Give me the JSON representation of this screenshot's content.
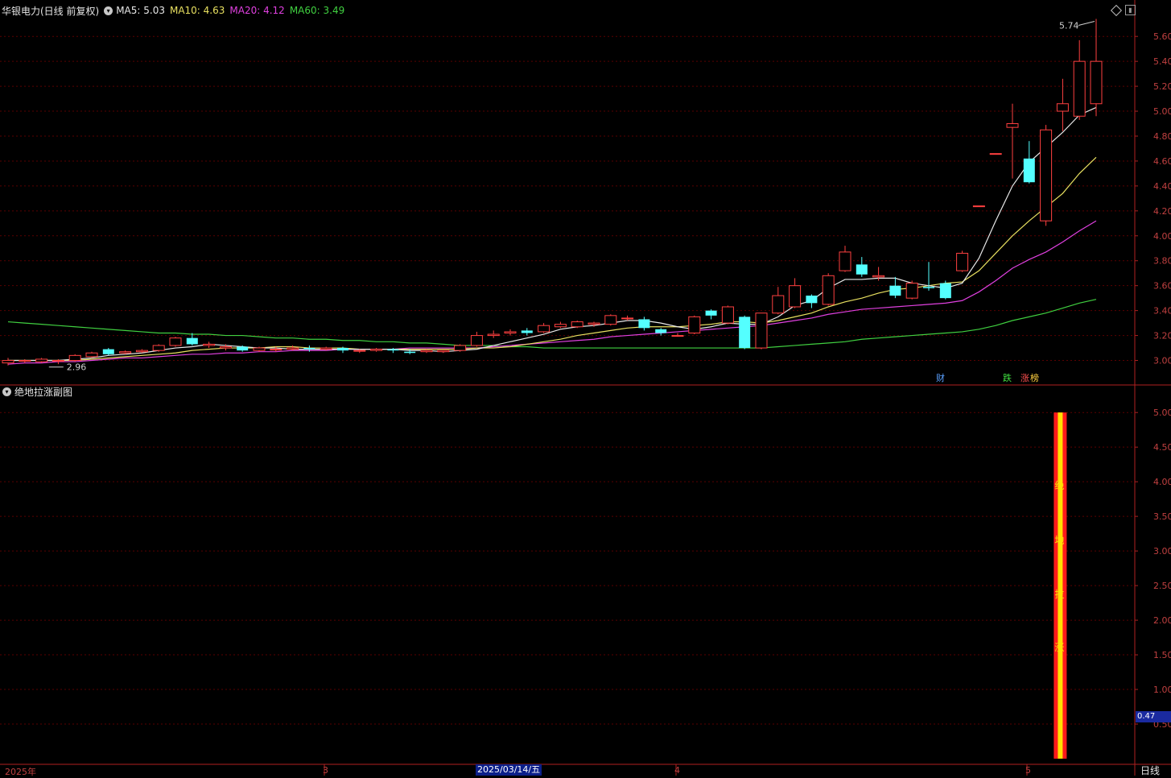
{
  "header": {
    "title": "华银电力(日线 前复权)",
    "indicators": [
      {
        "label": "MA5: 5.03",
        "color": "#e8e8e8"
      },
      {
        "label": "MA10: 4.63",
        "color": "#e8e060"
      },
      {
        "label": "MA20: 4.12",
        "color": "#e040e0"
      },
      {
        "label": "MA60: 3.49",
        "color": "#40d040"
      }
    ]
  },
  "main_axis": {
    "ticks": [
      "5.60",
      "5.40",
      "5.20",
      "5.00",
      "4.80",
      "4.60",
      "4.40",
      "4.20",
      "4.00",
      "3.80",
      "3.60",
      "3.40",
      "3.20",
      "3.00"
    ]
  },
  "annotations": {
    "high": "5.74",
    "low": "2.96"
  },
  "markers": [
    {
      "text": "财",
      "color": "#5aa0ff"
    },
    {
      "text": "跌",
      "color": "#40e040"
    },
    {
      "text": "涨",
      "color": "#ff5050"
    },
    {
      "text": "榜",
      "color": "#ffd040"
    }
  ],
  "sub": {
    "title": "绝地拉涨副图",
    "ticks": [
      "5.00",
      "4.50",
      "4.00",
      "3.50",
      "3.00",
      "2.50",
      "2.00",
      "1.50",
      "1.00",
      "0.50"
    ],
    "value_label": "0.47",
    "bar_chars": [
      "绝",
      "地",
      "拉",
      "涨"
    ]
  },
  "x_axis": {
    "labels": [
      "2025年",
      "3",
      "4",
      "5"
    ],
    "selected": "2025/03/14/五",
    "period": "日线"
  },
  "colors": {
    "up": "#ff4040",
    "down": "#54ffff",
    "grid": "#5a0000",
    "axis": "#b02020"
  },
  "chart_data": {
    "type": "candlestick",
    "ylim": [
      2.9,
      5.75
    ],
    "candles": [
      [
        2.98,
        3.0,
        2.96,
        3.02
      ],
      [
        3.0,
        3.0,
        2.98,
        3.01
      ],
      [
        2.99,
        3.01,
        2.98,
        3.02
      ],
      [
        3.0,
        3.0,
        2.97,
        3.01
      ],
      [
        3.0,
        3.04,
        2.99,
        3.05
      ],
      [
        3.03,
        3.06,
        3.02,
        3.07
      ],
      [
        3.09,
        3.05,
        3.04,
        3.1
      ],
      [
        3.06,
        3.07,
        3.05,
        3.08
      ],
      [
        3.07,
        3.08,
        3.06,
        3.09
      ],
      [
        3.08,
        3.12,
        3.07,
        3.13
      ],
      [
        3.12,
        3.18,
        3.11,
        3.19
      ],
      [
        3.18,
        3.13,
        3.12,
        3.22
      ],
      [
        3.12,
        3.13,
        3.1,
        3.15
      ],
      [
        3.1,
        3.11,
        3.08,
        3.13
      ],
      [
        3.11,
        3.08,
        3.07,
        3.12
      ],
      [
        3.08,
        3.1,
        3.07,
        3.11
      ],
      [
        3.09,
        3.09,
        3.07,
        3.11
      ],
      [
        3.09,
        3.1,
        3.08,
        3.12
      ],
      [
        3.1,
        3.09,
        3.07,
        3.12
      ],
      [
        3.09,
        3.1,
        3.08,
        3.11
      ],
      [
        3.1,
        3.08,
        3.06,
        3.11
      ],
      [
        3.08,
        3.08,
        3.06,
        3.09
      ],
      [
        3.08,
        3.09,
        3.07,
        3.1
      ],
      [
        3.09,
        3.08,
        3.06,
        3.1
      ],
      [
        3.07,
        3.06,
        3.05,
        3.09
      ],
      [
        3.07,
        3.08,
        3.06,
        3.09
      ],
      [
        3.07,
        3.08,
        3.06,
        3.08
      ],
      [
        3.08,
        3.12,
        3.07,
        3.13
      ],
      [
        3.12,
        3.2,
        3.11,
        3.23
      ],
      [
        3.2,
        3.21,
        3.18,
        3.24
      ],
      [
        3.22,
        3.23,
        3.2,
        3.25
      ],
      [
        3.24,
        3.22,
        3.2,
        3.26
      ],
      [
        3.23,
        3.28,
        3.22,
        3.3
      ],
      [
        3.27,
        3.29,
        3.26,
        3.31
      ],
      [
        3.27,
        3.31,
        3.26,
        3.32
      ],
      [
        3.29,
        3.3,
        3.27,
        3.31
      ],
      [
        3.29,
        3.36,
        3.28,
        3.37
      ],
      [
        3.34,
        3.34,
        3.32,
        3.36
      ],
      [
        3.33,
        3.26,
        3.24,
        3.35
      ],
      [
        3.25,
        3.22,
        3.2,
        3.26
      ],
      [
        3.2,
        3.2,
        3.19,
        3.22
      ],
      [
        3.22,
        3.35,
        3.21,
        3.36
      ],
      [
        3.4,
        3.36,
        3.33,
        3.41
      ],
      [
        3.3,
        3.43,
        3.29,
        3.44
      ],
      [
        3.35,
        3.1,
        3.09,
        3.36
      ],
      [
        3.1,
        3.38,
        3.09,
        3.38
      ],
      [
        3.38,
        3.52,
        3.37,
        3.59
      ],
      [
        3.43,
        3.6,
        3.42,
        3.66
      ],
      [
        3.52,
        3.46,
        3.42,
        3.53
      ],
      [
        3.45,
        3.68,
        3.44,
        3.7
      ],
      [
        3.72,
        3.87,
        3.71,
        3.92
      ],
      [
        3.77,
        3.69,
        3.67,
        3.83
      ],
      [
        3.67,
        3.68,
        3.64,
        3.75
      ],
      [
        3.6,
        3.52,
        3.5,
        3.67
      ],
      [
        3.5,
        3.62,
        3.49,
        3.64
      ],
      [
        3.59,
        3.58,
        3.56,
        3.79
      ],
      [
        3.62,
        3.5,
        3.49,
        3.64
      ],
      [
        3.72,
        3.86,
        3.71,
        3.88
      ],
      [
        4.24,
        4.24,
        4.24,
        4.24
      ],
      [
        4.66,
        4.66,
        4.66,
        4.66
      ],
      [
        4.87,
        4.9,
        4.46,
        5.06
      ],
      [
        4.62,
        4.43,
        4.42,
        4.76
      ],
      [
        4.12,
        4.85,
        4.08,
        4.89
      ],
      [
        5.0,
        5.06,
        4.84,
        5.26
      ],
      [
        4.96,
        5.4,
        4.93,
        5.57
      ],
      [
        5.06,
        5.4,
        4.96,
        5.74
      ]
    ],
    "ma5": [
      3.0,
      3.0,
      3.0,
      3.0,
      3.01,
      3.02,
      3.04,
      3.05,
      3.06,
      3.08,
      3.1,
      3.11,
      3.13,
      3.12,
      3.11,
      3.1,
      3.1,
      3.09,
      3.09,
      3.09,
      3.09,
      3.09,
      3.09,
      3.09,
      3.08,
      3.08,
      3.07,
      3.08,
      3.09,
      3.12,
      3.15,
      3.18,
      3.21,
      3.25,
      3.27,
      3.28,
      3.3,
      3.32,
      3.32,
      3.3,
      3.27,
      3.25,
      3.27,
      3.3,
      3.29,
      3.29,
      3.35,
      3.44,
      3.48,
      3.58,
      3.65,
      3.65,
      3.66,
      3.66,
      3.62,
      3.6,
      3.58,
      3.62,
      3.82,
      4.12,
      4.4,
      4.59,
      4.71,
      4.83,
      4.97,
      5.03
    ],
    "ma10": [
      3.0,
      3.0,
      3.0,
      3.0,
      3.0,
      3.01,
      3.02,
      3.03,
      3.04,
      3.05,
      3.06,
      3.08,
      3.09,
      3.1,
      3.1,
      3.1,
      3.11,
      3.11,
      3.1,
      3.1,
      3.1,
      3.09,
      3.09,
      3.09,
      3.09,
      3.09,
      3.09,
      3.09,
      3.1,
      3.1,
      3.11,
      3.13,
      3.15,
      3.17,
      3.2,
      3.22,
      3.24,
      3.26,
      3.27,
      3.27,
      3.27,
      3.28,
      3.29,
      3.31,
      3.31,
      3.3,
      3.32,
      3.35,
      3.38,
      3.43,
      3.47,
      3.5,
      3.54,
      3.57,
      3.58,
      3.6,
      3.62,
      3.63,
      3.72,
      3.86,
      4.0,
      4.12,
      4.23,
      4.34,
      4.5,
      4.63
    ],
    "ma20": [
      2.97,
      2.98,
      2.98,
      2.99,
      2.99,
      3.0,
      3.01,
      3.02,
      3.02,
      3.03,
      3.04,
      3.05,
      3.05,
      3.06,
      3.06,
      3.07,
      3.07,
      3.08,
      3.08,
      3.08,
      3.09,
      3.09,
      3.09,
      3.09,
      3.1,
      3.1,
      3.1,
      3.1,
      3.1,
      3.11,
      3.12,
      3.13,
      3.14,
      3.15,
      3.16,
      3.17,
      3.19,
      3.2,
      3.21,
      3.22,
      3.23,
      3.24,
      3.25,
      3.26,
      3.27,
      3.28,
      3.3,
      3.32,
      3.34,
      3.37,
      3.39,
      3.41,
      3.42,
      3.43,
      3.44,
      3.45,
      3.46,
      3.48,
      3.55,
      3.64,
      3.74,
      3.81,
      3.87,
      3.95,
      4.04,
      4.12
    ],
    "ma60": [
      3.31,
      3.3,
      3.29,
      3.28,
      3.27,
      3.26,
      3.25,
      3.24,
      3.23,
      3.22,
      3.22,
      3.21,
      3.21,
      3.2,
      3.2,
      3.19,
      3.18,
      3.18,
      3.17,
      3.17,
      3.16,
      3.16,
      3.15,
      3.15,
      3.14,
      3.14,
      3.13,
      3.12,
      3.12,
      3.12,
      3.11,
      3.11,
      3.1,
      3.1,
      3.1,
      3.1,
      3.1,
      3.1,
      3.1,
      3.1,
      3.1,
      3.1,
      3.1,
      3.1,
      3.1,
      3.1,
      3.11,
      3.12,
      3.13,
      3.14,
      3.15,
      3.17,
      3.18,
      3.19,
      3.2,
      3.21,
      3.22,
      3.23,
      3.25,
      3.28,
      3.32,
      3.35,
      3.38,
      3.42,
      3.46,
      3.49
    ],
    "sub_ylim": [
      0,
      5.2
    ],
    "sub_bar": {
      "index": 63,
      "value": 5.0
    }
  }
}
